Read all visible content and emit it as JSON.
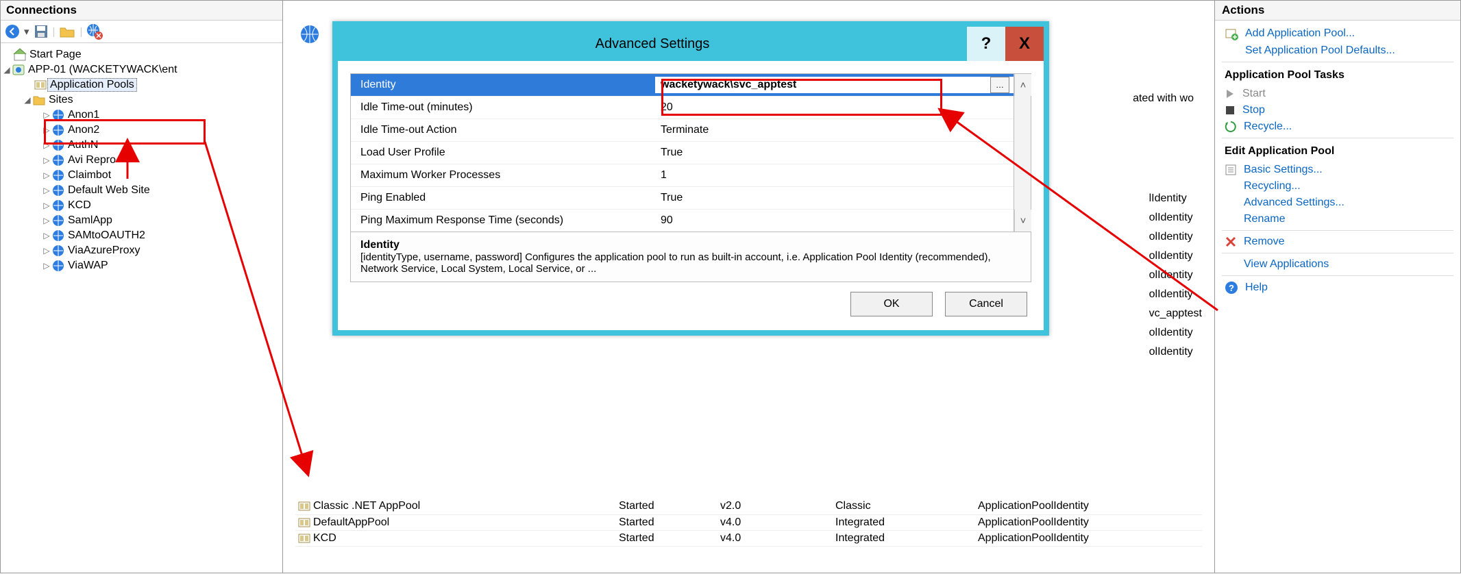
{
  "connections": {
    "title": "Connections",
    "tree": {
      "start_page": "Start Page",
      "server": "APP-01 (WACKETYWACK\\ent",
      "app_pools": "Application Pools",
      "sites_label": "Sites",
      "sites": [
        "Anon1",
        "Anon2",
        "AuthN",
        "Avi Repro",
        "Claimbot",
        "Default Web Site",
        "KCD",
        "SamlApp",
        "SAMtoOAUTH2",
        "ViaAzureProxy",
        "ViaWAP"
      ]
    }
  },
  "center": {
    "bg_text_trail": "ated with wo",
    "bg_identities": [
      "lIdentity",
      "olIdentity",
      "olIdentity",
      "olIdentity",
      "olIdentity",
      "olIdentity",
      "vc_apptest",
      "olIdentity",
      "olIdentity"
    ],
    "pools": [
      {
        "name": "Classic .NET AppPool",
        "status": "Started",
        "net": "v2.0",
        "mode": "Classic",
        "identity": "ApplicationPoolIdentity"
      },
      {
        "name": "DefaultAppPool",
        "status": "Started",
        "net": "v4.0",
        "mode": "Integrated",
        "identity": "ApplicationPoolIdentity"
      },
      {
        "name": "KCD",
        "status": "Started",
        "net": "v4.0",
        "mode": "Integrated",
        "identity": "ApplicationPoolIdentity"
      }
    ]
  },
  "dialog": {
    "title": "Advanced Settings",
    "help": "?",
    "close": "X",
    "rows": [
      {
        "name": "Identity",
        "value": "wacketywack\\svc_apptest",
        "selected": true,
        "editor": true
      },
      {
        "name": "Idle Time-out (minutes)",
        "value": "20"
      },
      {
        "name": "Idle Time-out Action",
        "value": "Terminate"
      },
      {
        "name": "Load User Profile",
        "value": "True"
      },
      {
        "name": "Maximum Worker Processes",
        "value": "1"
      },
      {
        "name": "Ping Enabled",
        "value": "True"
      },
      {
        "name": "Ping Maximum Response Time (seconds)",
        "value": "90"
      }
    ],
    "desc_title": "Identity",
    "desc_body": "[identityType, username, password] Configures the application pool to run as built-in account, i.e. Application Pool Identity (recommended), Network Service, Local System, Local Service, or ...",
    "ok": "OK",
    "cancel": "Cancel"
  },
  "actions": {
    "title": "Actions",
    "add_pool": "Add Application Pool...",
    "set_defaults": "Set Application Pool Defaults...",
    "group_tasks": "Application Pool Tasks",
    "start": "Start",
    "stop": "Stop",
    "recycle": "Recycle...",
    "group_edit": "Edit Application Pool",
    "basic": "Basic Settings...",
    "recycling": "Recycling...",
    "advanced": "Advanced Settings...",
    "rename": "Rename",
    "remove": "Remove",
    "view_apps": "View Applications",
    "help": "Help"
  }
}
